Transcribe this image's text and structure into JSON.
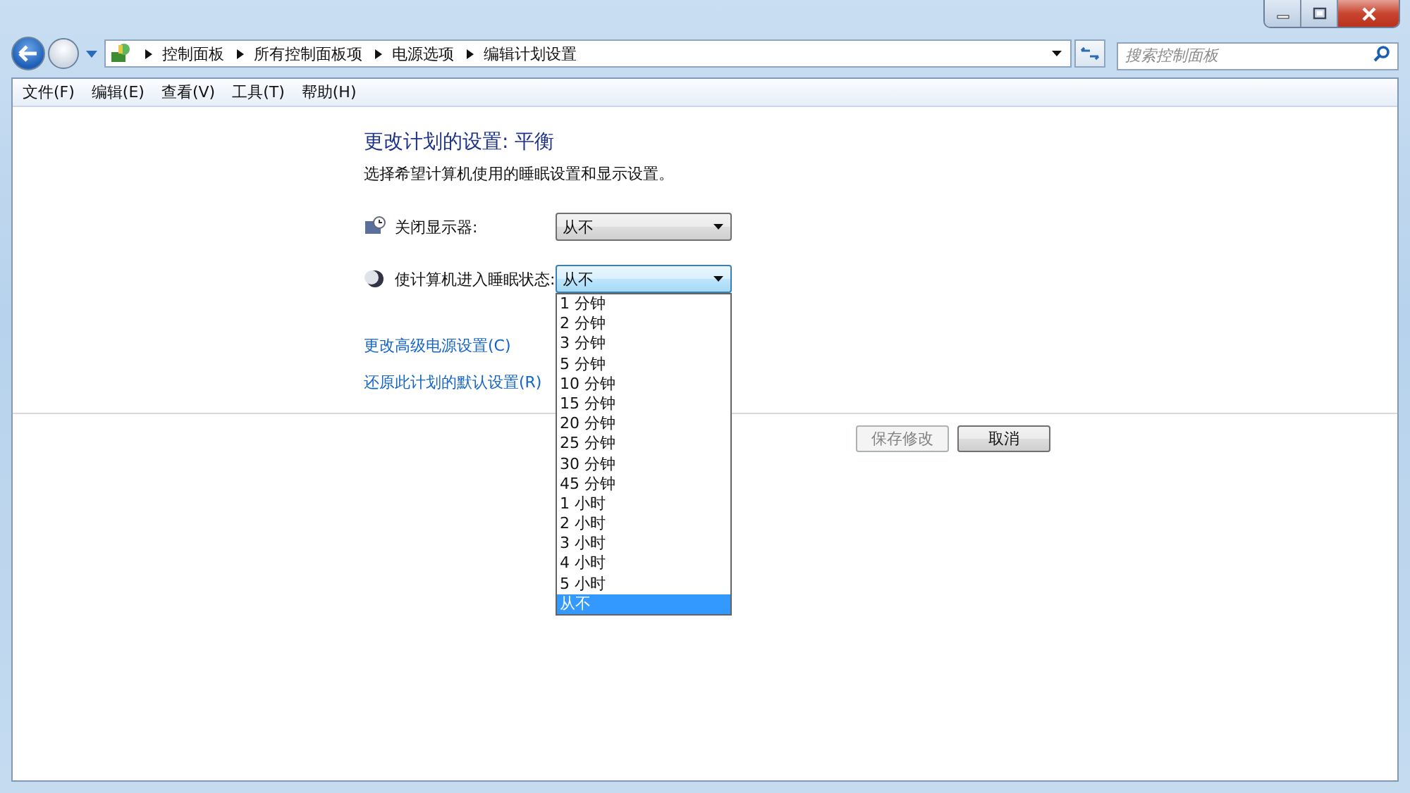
{
  "nav": {
    "breadcrumb": [
      "控制面板",
      "所有控制面板项",
      "电源选项",
      "编辑计划设置"
    ],
    "search": {
      "placeholder": "搜索控制面板"
    }
  },
  "menu": [
    "文件(F)",
    "编辑(E)",
    "查看(V)",
    "工具(T)",
    "帮助(H)"
  ],
  "heading": "更改计划的设置: 平衡",
  "description": "选择希望计算机使用的睡眠设置和显示设置。",
  "settings": [
    {
      "kind": "display",
      "label": "关闭显示器:",
      "value": "从不",
      "expanded": false
    },
    {
      "kind": "sleep",
      "label": "使计算机进入睡眠状态:",
      "value": "从不",
      "expanded": true,
      "options": [
        {
          "label": "1 分钟",
          "selected": false
        },
        {
          "label": "2 分钟",
          "selected": false
        },
        {
          "label": "3 分钟",
          "selected": false
        },
        {
          "label": "5 分钟",
          "selected": false
        },
        {
          "label": "10 分钟",
          "selected": false
        },
        {
          "label": "15 分钟",
          "selected": false
        },
        {
          "label": "20 分钟",
          "selected": false
        },
        {
          "label": "25 分钟",
          "selected": false
        },
        {
          "label": "30 分钟",
          "selected": false
        },
        {
          "label": "45 分钟",
          "selected": false
        },
        {
          "label": "1 小时",
          "selected": false
        },
        {
          "label": "2 小时",
          "selected": false
        },
        {
          "label": "3 小时",
          "selected": false
        },
        {
          "label": "4 小时",
          "selected": false
        },
        {
          "label": "5 小时",
          "selected": false
        },
        {
          "label": "从不",
          "selected": true
        }
      ]
    }
  ],
  "links": [
    "更改高级电源设置(C)",
    "还原此计划的默认设置(R)"
  ],
  "buttons": [
    {
      "label": "保存修改",
      "disabled": true
    },
    {
      "label": "取消",
      "disabled": false
    }
  ]
}
